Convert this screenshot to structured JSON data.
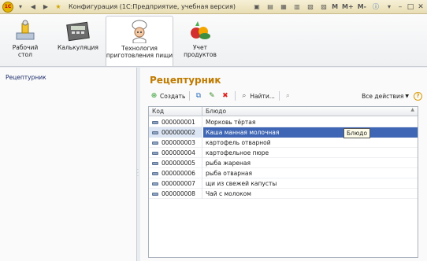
{
  "window": {
    "title": "Конфигурация  (1С:Предприятие, учебная версия)",
    "title_buttons": [
      "M",
      "M+",
      "M-"
    ]
  },
  "sections": [
    {
      "label": "Рабочий\nстол",
      "icon": "desktop-icon"
    },
    {
      "label": "Калькуляция",
      "icon": "calculator-icon"
    },
    {
      "label": "Технология\nприготовления пищи",
      "icon": "chef-icon",
      "active": true
    },
    {
      "label": "Учет\nпродуктов",
      "icon": "vegetables-icon"
    }
  ],
  "nav": {
    "items": [
      {
        "label": "Рецептурник"
      }
    ]
  },
  "form": {
    "title": "Рецептурник",
    "toolbar": {
      "create_label": "Создать",
      "find_label": "Найти...",
      "all_actions_label": "Все действия",
      "help_label": "?"
    },
    "columns": {
      "code": "Код",
      "dish": "Блюдо"
    },
    "rows": [
      {
        "code": "000000001",
        "dish": "Морковь тёртая"
      },
      {
        "code": "000000002",
        "dish": "Каша манная молочная"
      },
      {
        "code": "000000003",
        "dish": "картофель отварной"
      },
      {
        "code": "000000004",
        "dish": "картофельное пюре"
      },
      {
        "code": "000000005",
        "dish": "рыба жареная"
      },
      {
        "code": "000000006",
        "dish": "рыба отварная"
      },
      {
        "code": "000000007",
        "dish": "щи из свежей капусты"
      },
      {
        "code": "000000008",
        "dish": "Чай с молоком"
      }
    ],
    "selected_row_index": 1,
    "tooltip": "Блюдо"
  }
}
